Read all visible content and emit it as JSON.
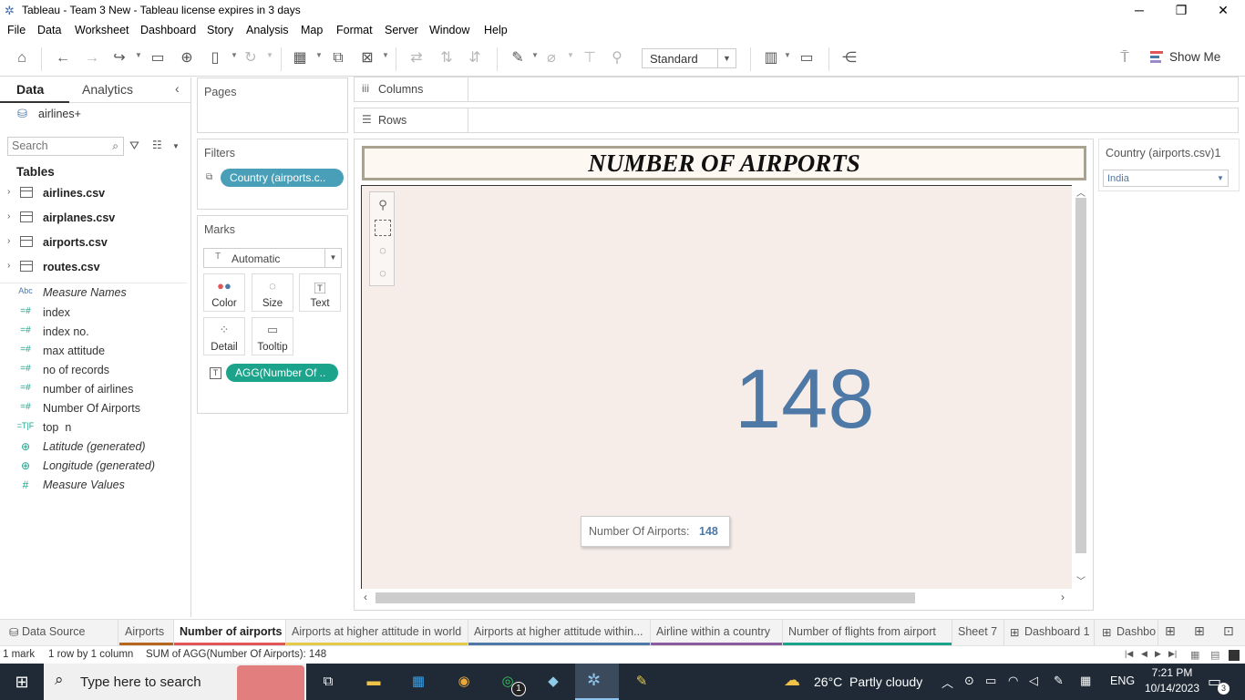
{
  "window": {
    "title": "Tableau - Team 3 New - Tableau license expires in 3 days",
    "minimize": "─",
    "restore": "❐",
    "close": "✕"
  },
  "menu": [
    "File",
    "Data",
    "Worksheet",
    "Dashboard",
    "Story",
    "Analysis",
    "Map",
    "Format",
    "Server",
    "Window",
    "Help"
  ],
  "toolbar": {
    "fit_mode": "Standard",
    "show_me": "Show Me"
  },
  "data_pane": {
    "tabs": [
      "Data",
      "Analytics"
    ],
    "datasource": "airlines+",
    "search_placeholder": "Search",
    "tables_heading": "Tables",
    "tables": [
      "airlines.csv",
      "airplanes.csv",
      "airports.csv",
      "routes.csv"
    ],
    "fields": [
      {
        "icon": "Abc",
        "label": "Measure Names",
        "italic": true
      },
      {
        "icon": "=#",
        "label": "index"
      },
      {
        "icon": "=#",
        "label": "index no."
      },
      {
        "icon": "=#",
        "label": "max attitude"
      },
      {
        "icon": "=#",
        "label": "no of records"
      },
      {
        "icon": "=#",
        "label": "number of airlines"
      },
      {
        "icon": "=#",
        "label": "Number Of Airports"
      },
      {
        "icon": "=T|F",
        "label": "top  n"
      },
      {
        "icon": "globe",
        "label": "Latitude (generated)",
        "italic": true
      },
      {
        "icon": "globe",
        "label": "Longitude (generated)",
        "italic": true
      },
      {
        "icon": "#",
        "label": "Measure Values",
        "italic": true
      }
    ]
  },
  "cards": {
    "pages": "Pages",
    "filters": "Filters",
    "filter_pill": "Country (airports.c..",
    "marks": "Marks",
    "mark_type": "Automatic",
    "mark_buttons": [
      "Color",
      "Size",
      "Text",
      "Detail",
      "Tooltip"
    ],
    "marks_pill": "AGG(Number Of .."
  },
  "shelves": {
    "columns": "Columns",
    "rows": "Rows"
  },
  "view": {
    "title": "NUMBER OF AIRPORTS",
    "value": "148",
    "tooltip_label": "Number Of Airports:",
    "tooltip_value": "148"
  },
  "quick_filter": {
    "title": "Country (airports.csv)1",
    "value": "India"
  },
  "sheet_tabs": [
    {
      "label": "Data Source",
      "color": ""
    },
    {
      "label": "Airports",
      "color": "#b5661c"
    },
    {
      "label": "Number of airports",
      "color": "#e15759",
      "active": true
    },
    {
      "label": "Airports at higher attitude in world",
      "color": "#e5c94a"
    },
    {
      "label": "Airports at higher attitude within...",
      "color": "#4e79a7"
    },
    {
      "label": "Airline within a country",
      "color": "#8b5c9e"
    },
    {
      "label": "Number of flights from airport",
      "color": "#1ca38b"
    },
    {
      "label": "Sheet 7",
      "color": ""
    },
    {
      "label": "Dashboard 1",
      "color": ""
    },
    {
      "label": "Dashbo",
      "color": ""
    }
  ],
  "status": {
    "marks": "1 mark",
    "dims": "1 row by 1 column",
    "sum": "SUM of AGG(Number Of Airports): 148"
  },
  "taskbar": {
    "search_placeholder": "Type here to search",
    "weather": "26°C  Partly cloudy",
    "lang": "ENG",
    "time": "7:21 PM",
    "date": "10/14/2023",
    "notifications": "3",
    "whatsapp_badge": "1"
  }
}
